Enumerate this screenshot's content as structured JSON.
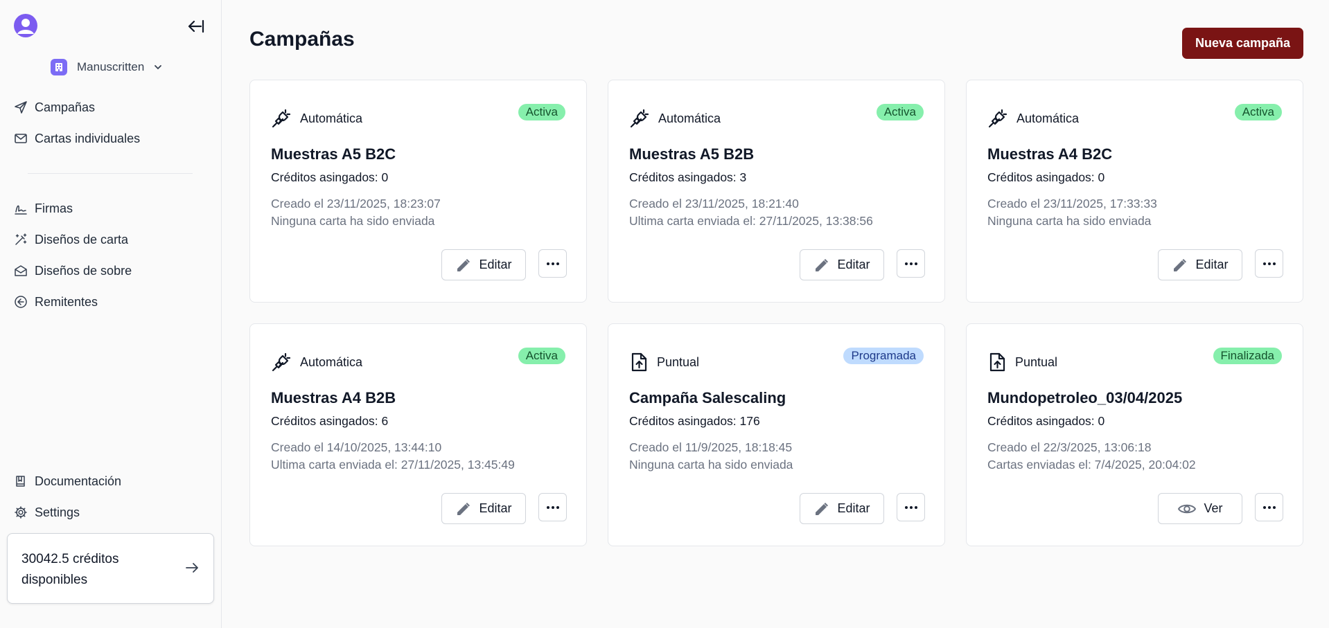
{
  "sidebar": {
    "org_name": "Manuscritten",
    "nav_primary": [
      {
        "label": "Campañas",
        "icon": "send-icon"
      },
      {
        "label": "Cartas individuales",
        "icon": "mail-icon"
      }
    ],
    "nav_secondary": [
      {
        "label": "Firmas",
        "icon": "signature-icon"
      },
      {
        "label": "Diseños de carta",
        "icon": "magic-wand-icon"
      },
      {
        "label": "Diseños de sobre",
        "icon": "envelope-open-icon"
      },
      {
        "label": "Remitentes",
        "icon": "arrow-left-circle-icon"
      }
    ],
    "nav_bottom": [
      {
        "label": "Documentación",
        "icon": "book-icon"
      },
      {
        "label": "Settings",
        "icon": "gear-icon"
      }
    ],
    "credits": "30042.5 créditos disponibles"
  },
  "main": {
    "title": "Campañas",
    "new_button": "Nueva campaña",
    "cards": [
      {
        "type": "Automática",
        "status": "Activa",
        "status_color": "green",
        "title": "Muestras A5 B2C",
        "credits": "Créditos asingados: 0",
        "created": "Creado el 23/11/2025, 18:23:07",
        "sent": "Ninguna carta ha sido enviada",
        "action": "Editar"
      },
      {
        "type": "Automática",
        "status": "Activa",
        "status_color": "green",
        "title": "Muestras A5 B2B",
        "credits": "Créditos asingados: 3",
        "created": "Creado el 23/11/2025, 18:21:40",
        "sent": "Ultima carta enviada el: 27/11/2025, 13:38:56",
        "action": "Editar"
      },
      {
        "type": "Automática",
        "status": "Activa",
        "status_color": "green",
        "title": "Muestras A4 B2C",
        "credits": "Créditos asingados: 0",
        "created": "Creado el 23/11/2025, 17:33:33",
        "sent": "Ninguna carta ha sido enviada",
        "action": "Editar"
      },
      {
        "type": "Automática",
        "status": "Activa",
        "status_color": "green",
        "title": "Muestras A4 B2B",
        "credits": "Créditos asingados: 6",
        "created": "Creado el 14/10/2025, 13:44:10",
        "sent": "Ultima carta enviada el: 27/11/2025, 13:45:49",
        "action": "Editar"
      },
      {
        "type": "Puntual",
        "status": "Programada",
        "status_color": "blue",
        "title": "Campaña Salescaling",
        "credits": "Créditos asingados: 176",
        "created": "Creado el 11/9/2025, 18:18:45",
        "sent": "Ninguna carta ha sido enviada",
        "action": "Editar"
      },
      {
        "type": "Puntual",
        "status": "Finalizada",
        "status_color": "green",
        "title": "Mundopetroleo_03/04/2025",
        "credits": "Créditos asingados: 0",
        "created": "Creado el 22/3/2025, 13:06:18",
        "sent": "Cartas enviadas el: 7/4/2025, 20:04:02",
        "action": "Ver"
      }
    ]
  },
  "colors": {
    "accent": "#7a1414",
    "badge_green": "#86efac",
    "badge_blue": "#bfdbfe",
    "avatar": "#7c5cf0"
  }
}
